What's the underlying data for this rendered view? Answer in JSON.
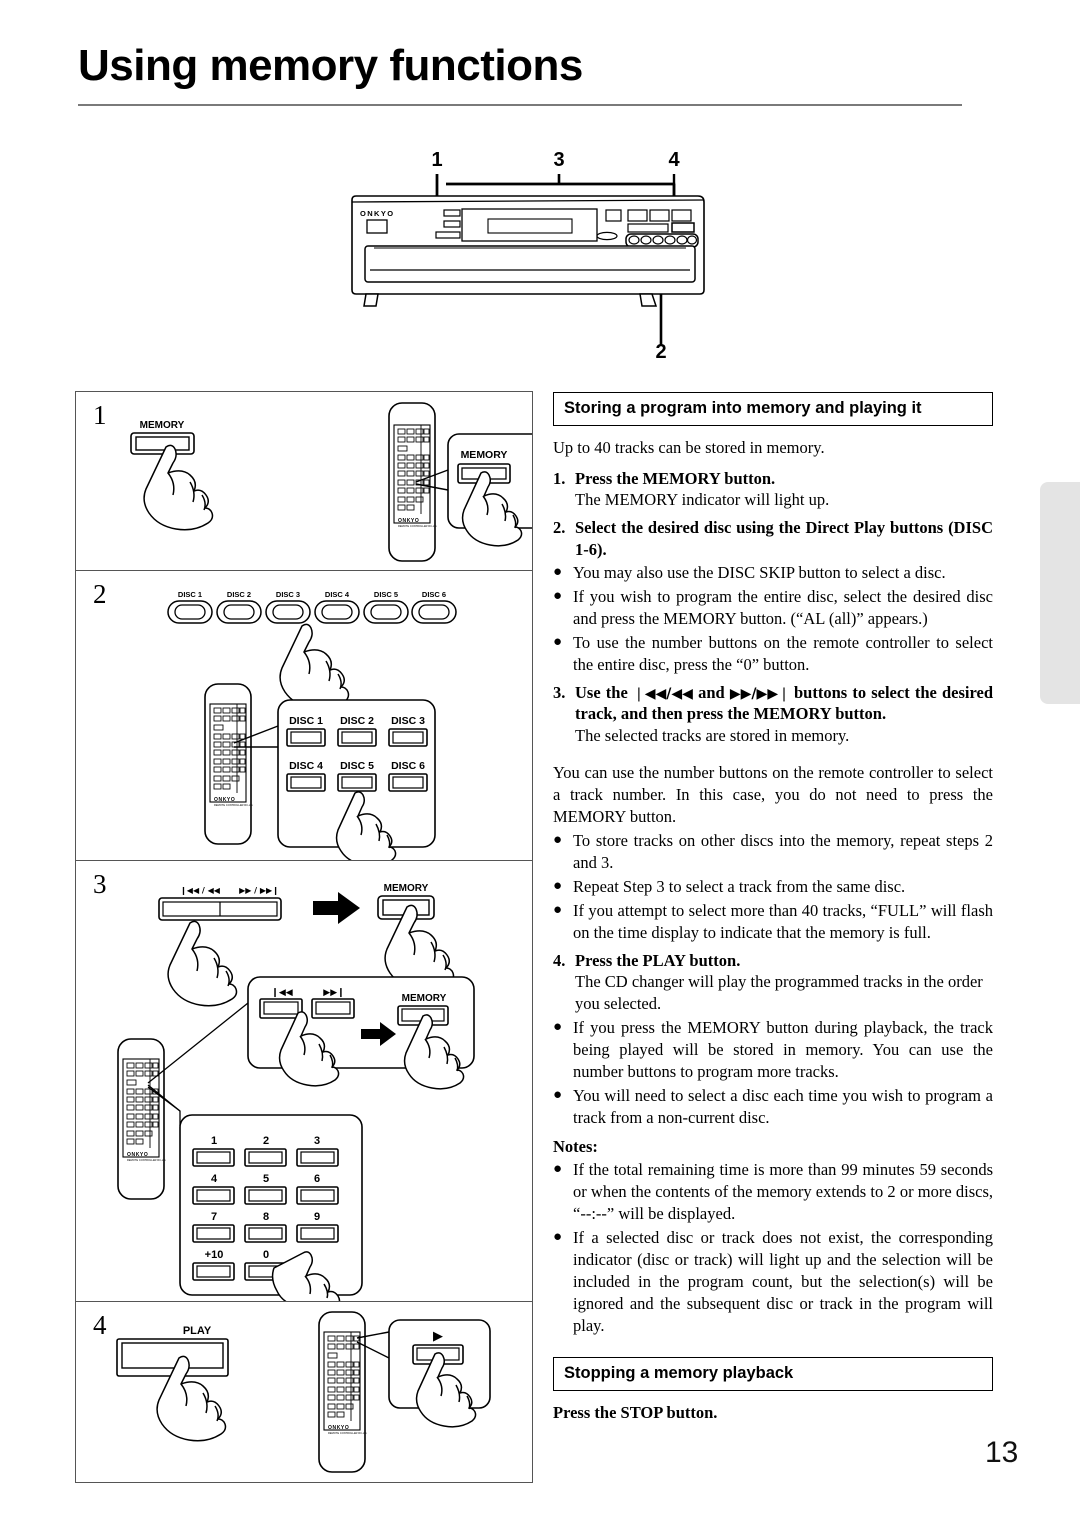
{
  "page": {
    "title": "Using memory functions",
    "number": "13"
  },
  "device_diagram": {
    "brand": "ONKYO",
    "callouts": [
      "1",
      "3",
      "4",
      "2"
    ]
  },
  "steps_figures": [
    {
      "num": "1",
      "front_button_label": "MEMORY",
      "callout_button_label": "MEMORY",
      "remote_brand": "ONKYO"
    },
    {
      "num": "2",
      "front_disc_labels": [
        "DISC 1",
        "DISC 2",
        "DISC 3",
        "DISC 4",
        "DISC 5",
        "DISC 6"
      ],
      "callout_disc_labels": [
        "DISC 1",
        "DISC 2",
        "DISC 3",
        "DISC 4",
        "DISC 5",
        "DISC 6"
      ],
      "remote_brand": "ONKYO"
    },
    {
      "num": "3",
      "front_skip_back_label": "❘◀◀ / ◀◀",
      "front_skip_fwd_label": "▶▶ / ▶▶❘",
      "front_memory_label": "MEMORY",
      "callout_skip_back_label": "❘◀◀",
      "callout_skip_fwd_label": "▶▶❘",
      "callout_memory_label": "MEMORY",
      "numeric_keys": [
        "1",
        "2",
        "3",
        "4",
        "5",
        "6",
        "7",
        "8",
        "9",
        "+10",
        "0"
      ],
      "remote_brand": "ONKYO"
    },
    {
      "num": "4",
      "front_button_label": "PLAY",
      "callout_button_label": "▶",
      "remote_brand": "ONKYO"
    }
  ],
  "section1": {
    "heading": "Storing a program into memory and playing it",
    "intro": "Up to 40 tracks can be stored in memory.",
    "step1_num": "1.",
    "step1_title": "Press the MEMORY button.",
    "step1_sub": "The MEMORY indicator will light up.",
    "step2_num": "2.",
    "step2_title": "Select the desired disc using the Direct Play buttons (DISC 1-6).",
    "step2_bullets": [
      "You may also use the DISC SKIP button to select a disc.",
      "If you wish to program the entire disc, select the desired disc and press the MEMORY button. (“AL (all)” appears.)",
      "To use the number buttons on the remote controller to select the entire disc, press the “0” button."
    ],
    "step3_num": "3.",
    "step3_title_pre": "Use the ",
    "step3_icon_a": "❘◀◀/◀◀",
    "step3_title_mid": " and ",
    "step3_icon_b": "▶▶/▶▶❘",
    "step3_title_post": " buttons to select the desired track, and then press the MEMORY button.",
    "step3_sub": "The selected tracks are stored in memory.",
    "para": "You can use the number buttons on the remote controller to select a track number. In this case, you do not need to press the MEMORY button.",
    "para_bullets": [
      "To store tracks on other discs into the memory, repeat steps 2 and 3.",
      "Repeat Step 3 to select a track from the same disc.",
      "If you attempt to select more than 40 tracks, “FULL” will flash on the time display to indicate that the memory is full."
    ],
    "step4_num": "4.",
    "step4_title": "Press the PLAY button.",
    "step4_sub": "The CD changer will play the programmed tracks in the order you selected.",
    "step4_bullets": [
      "If you press the MEMORY button during playback, the track being played will be stored in memory. You can use the number buttons to program more tracks.",
      "You will need to select a disc each time you wish to program a track from a non-current disc."
    ],
    "notes_heading": "Notes:",
    "notes_bullets": [
      "If the total remaining time is more than 99 minutes 59 seconds or when the contents of the memory extends to 2 or more discs, “--:--” will be displayed.",
      "If a selected disc or track does not exist, the corresponding indicator (disc or track) will light up and the selection will be included in the program count, but the selection(s) will be ignored and the subsequent disc or track in the program will play."
    ]
  },
  "section2": {
    "heading": "Stopping a memory playback",
    "line": "Press the STOP button."
  },
  "colors": {
    "rule": "#7a7a7a",
    "tab": "#e4e4e4",
    "ink": "#000000"
  }
}
